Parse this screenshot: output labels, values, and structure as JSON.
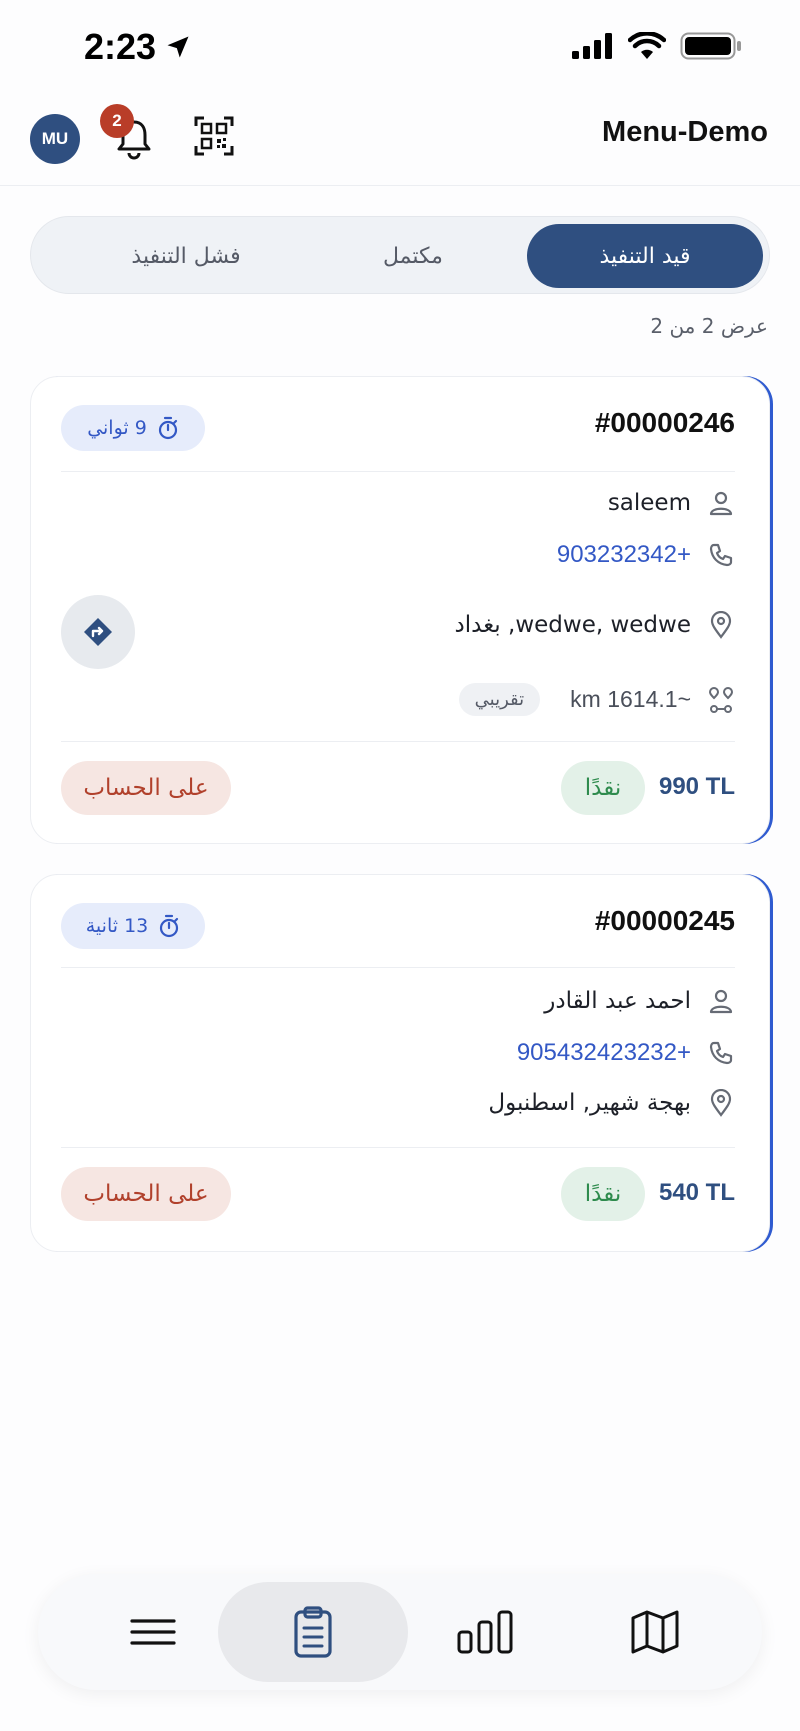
{
  "status_bar": {
    "time": "2:23"
  },
  "header": {
    "avatar_initials": "MU",
    "notification_count": "2",
    "title": "Menu-Demo"
  },
  "tabs": [
    {
      "label": "قيد التنفيذ",
      "active": true
    },
    {
      "label": "مكتمل",
      "active": false
    },
    {
      "label": "فشل التنفيذ",
      "active": false
    }
  ],
  "count_text": "عرض 2 من 2",
  "orders": [
    {
      "id": "#00000246",
      "timer": "9 ثواني",
      "customer": "saleem",
      "phone": "+903232342",
      "address": "wedwe, wedwe, بغداد",
      "distance": "~1614.1 km",
      "distance_tag": "تقريبي",
      "price": "990 TL",
      "payment": "نقدًا",
      "account": "على الحساب"
    },
    {
      "id": "#00000245",
      "timer": "13 ثانية",
      "customer": "احمد عبد القادر",
      "phone": "+905432423232",
      "address": "بهجة شهير, اسطنبول",
      "price": "540 TL",
      "payment": "نقدًا",
      "account": "على الحساب"
    }
  ],
  "bottom_nav": {
    "items": [
      "menu-icon",
      "orders-icon",
      "stats-icon",
      "map-icon"
    ],
    "active": "orders-icon"
  },
  "colors": {
    "primary": "#2f4f80",
    "accent_blue": "#3358c5",
    "cash_green": "#2e8b4d",
    "account_red": "#b1412c"
  }
}
